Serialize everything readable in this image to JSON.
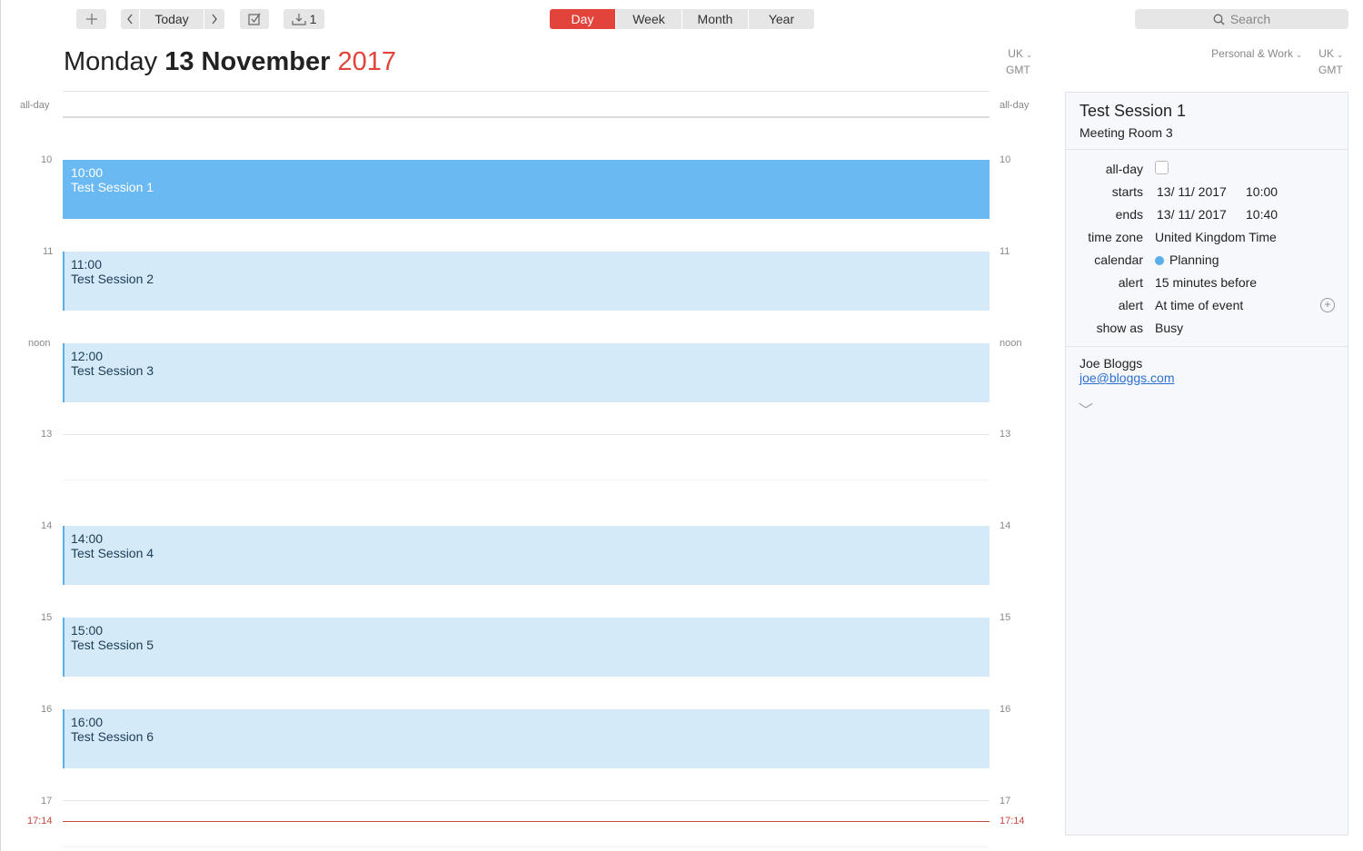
{
  "toolbar": {
    "add_icon": "plus-icon",
    "prev_icon": "chevron-left-icon",
    "today_label": "Today",
    "next_icon": "chevron-right-icon",
    "tasks_icon": "checkbox-icon",
    "inbox_count": "1",
    "views": [
      "Day",
      "Week",
      "Month",
      "Year"
    ],
    "active_view": "Day",
    "search_placeholder": "Search"
  },
  "header": {
    "weekday": "Monday",
    "date_month": "13 November",
    "year": "2017",
    "tz_region": "UK",
    "tz_zone": "GMT",
    "calendars_label": "Personal & Work",
    "right_tz_region": "UK",
    "right_tz_zone": "GMT"
  },
  "grid": {
    "allday_label": "all-day",
    "hours": [
      "10",
      "11",
      "noon",
      "13",
      "14",
      "15",
      "16",
      "17"
    ],
    "now_label": "17:14"
  },
  "events": [
    {
      "time": "10:00",
      "title": "Test Session 1",
      "selected": true
    },
    {
      "time": "11:00",
      "title": "Test Session 2",
      "selected": false
    },
    {
      "time": "12:00",
      "title": "Test Session 3",
      "selected": false
    },
    {
      "time": "14:00",
      "title": "Test Session 4",
      "selected": false
    },
    {
      "time": "15:00",
      "title": "Test Session 5",
      "selected": false
    },
    {
      "time": "16:00",
      "title": "Test Session 6",
      "selected": false
    }
  ],
  "inspector": {
    "title": "Test Session 1",
    "location": "Meeting Room 3",
    "allday_label": "all-day",
    "starts_label": "starts",
    "starts_date": "13/ 11/ 2017",
    "starts_time": "10:00",
    "ends_label": "ends",
    "ends_date": "13/ 11/ 2017",
    "ends_time": "10:40",
    "timezone_label": "time zone",
    "timezone_value": "United Kingdom Time",
    "calendar_label": "calendar",
    "calendar_value": "Planning",
    "calendar_color": "#5aaeea",
    "alert_label": "alert",
    "alert1_value": "15 minutes before",
    "alert2_value": "At time of event",
    "showas_label": "show as",
    "showas_value": "Busy",
    "contact_name": "Joe Bloggs",
    "contact_email": "joe@bloggs.com"
  },
  "colors": {
    "accent": "#e2433a",
    "event_selected": "#6ab9f3",
    "event_bg": "#d4eaf8",
    "now_line": "#c8473f"
  }
}
